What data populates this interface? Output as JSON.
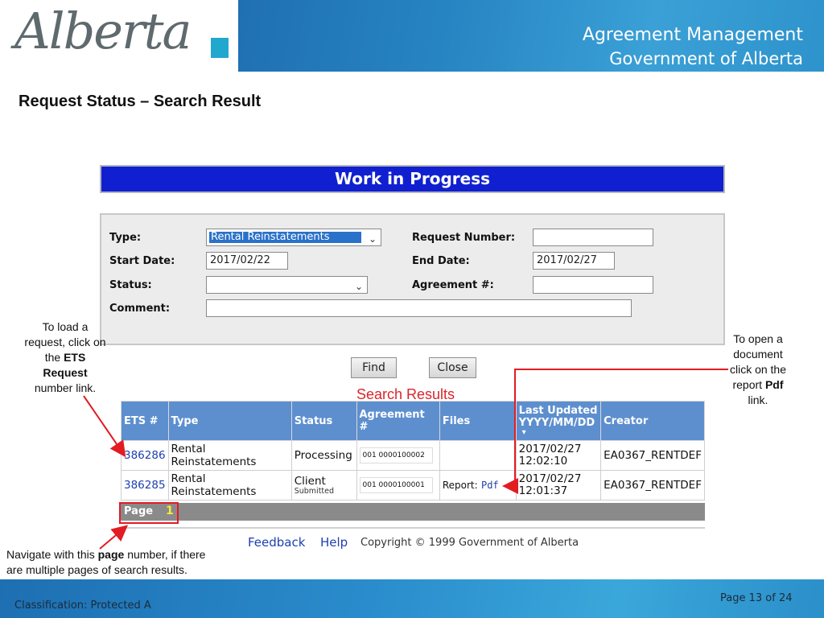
{
  "header": {
    "logo_text": "Alberta",
    "line1": "Agreement Management",
    "line2": "Government of Alberta"
  },
  "slide_title": "Request Status – Search Result",
  "app": {
    "banner": "Work in Progress",
    "form": {
      "type_label": "Type:",
      "type_value": "Rental Reinstatements",
      "request_number_label": "Request Number:",
      "request_number_value": "",
      "start_date_label": "Start Date:",
      "start_date_value": "2017/02/22",
      "end_date_label": "End Date:",
      "end_date_value": "2017/02/27",
      "status_label": "Status:",
      "status_value": "",
      "agreement_label": "Agreement #:",
      "agreement_value": "",
      "comment_label": "Comment:",
      "comment_value": ""
    },
    "find_label": "Find",
    "close_label": "Close",
    "search_results_label": "Search Results",
    "table": {
      "headers": {
        "ets": "ETS #",
        "type": "Type",
        "status": "Status",
        "agreement": "Agreement #",
        "files": "Files",
        "updated_line1": "Last Updated",
        "updated_line2": "YYYY/MM/DD",
        "creator": "Creator"
      },
      "rows": [
        {
          "ets": "386286",
          "type": "Rental Reinstatements",
          "status": "Processing",
          "status_sub": "",
          "agreement": "001 0000100002",
          "files_label": "",
          "files_link": "",
          "updated_date": "2017/02/27",
          "updated_time": "12:02:10",
          "creator": "EA0367_RENTDEF"
        },
        {
          "ets": "386285",
          "type": "Rental Reinstatements",
          "status": "Client",
          "status_sub": "Submitted",
          "agreement": "001 0000100001",
          "files_label": "Report:",
          "files_link": "Pdf",
          "updated_date": "2017/02/27",
          "updated_time": "12:01:37",
          "creator": "EA0367_RENTDEF"
        }
      ]
    },
    "pager_label": "Page",
    "pager_number": "1",
    "footer_links": {
      "feedback": "Feedback",
      "help": "Help",
      "copyright": "Copyright © 1999 Government of Alberta"
    }
  },
  "annotations": {
    "left_top": {
      "line1": "To load a",
      "line2": "request, click on",
      "line3": "the",
      "bold1": "ETS",
      "bold2": "Request",
      "line5": "number link."
    },
    "right_top": {
      "line1": "To open a",
      "line2": "document",
      "line3": "click on the",
      "line4": "report",
      "bold": "Pdf",
      "line5": "link."
    },
    "bottom_left": {
      "part1": "Navigate with this",
      "bold": "page",
      "part2": "number, if there",
      "line2": "are multiple pages of search results."
    }
  },
  "footer": {
    "classification": "Classification: Protected A",
    "page": "Page 13 of 24"
  },
  "colors": {
    "header_blue": "#2c90c9",
    "banner_blue": "#1020d0",
    "table_header": "#5d8fcf",
    "annotation_red": "#e31b23",
    "link_blue": "#1d3fb0"
  }
}
